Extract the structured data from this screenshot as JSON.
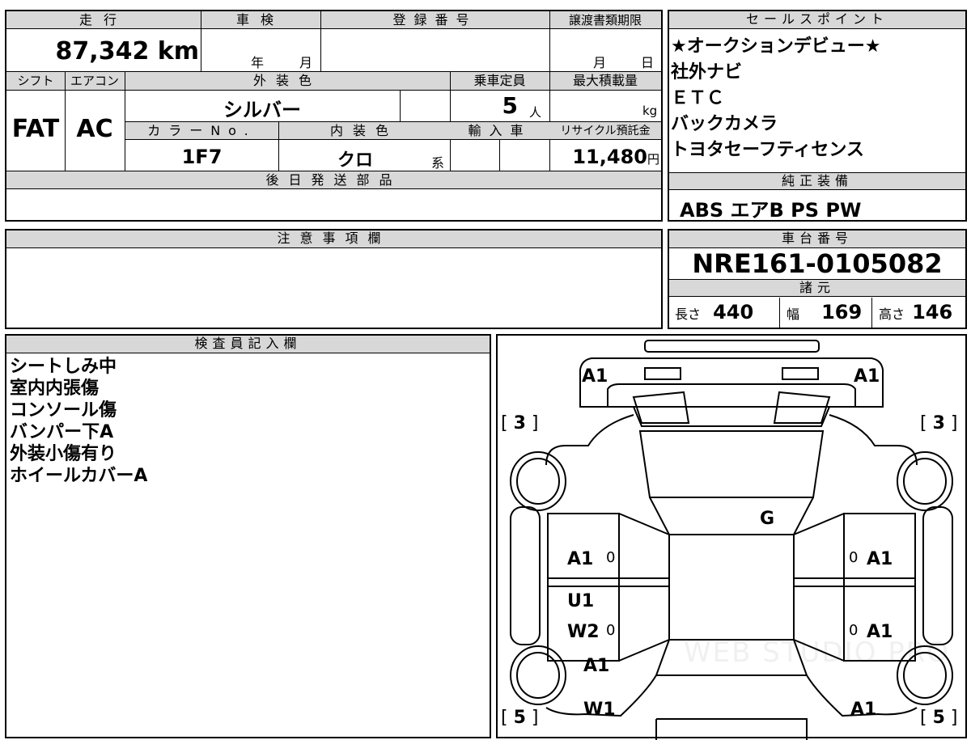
{
  "top_grid": {
    "headers": {
      "mileage": "走行",
      "inspection": "車検",
      "registration": "登録番号",
      "transfer_deadline": "譲渡書類期限",
      "shift": "シフト",
      "aircon": "エアコン",
      "exterior_color": "外装色",
      "capacity": "乗車定員",
      "max_load": "最大積載量",
      "color_no": "カラーNo.",
      "interior_color": "内装色",
      "import": "輸入車",
      "recycle": "リサイクル預託金",
      "later_parts": "後日発送部品"
    },
    "values": {
      "mileage": "87,342",
      "mileage_unit": "km",
      "inspection_year": "年",
      "inspection_month": "月",
      "transfer_month": "月",
      "transfer_day": "日",
      "shift": "FAT",
      "aircon": "AC",
      "exterior_color": "シルバー",
      "capacity": "5",
      "capacity_unit": "人",
      "max_load_unit": "kg",
      "color_no": "1F7",
      "interior_color": "クロ",
      "interior_suffix": "系",
      "recycle": "11,480",
      "recycle_unit": "円"
    }
  },
  "sales_points": {
    "header": "セールスポイント",
    "items": [
      "★オークションデビュー★",
      "社外ナビ",
      "ＥＴＣ",
      "バックカメラ",
      "トヨタセーフティセンス"
    ]
  },
  "genuine_equipment": {
    "header": "純正装備",
    "value": "ABS エアB PS PW"
  },
  "notes": {
    "header": "注意事項欄"
  },
  "chassis": {
    "header": "車台番号",
    "number": "NRE161-0105082",
    "specs_header": "諸元",
    "length_label": "長さ",
    "length": "440",
    "width_label": "幅",
    "width": "169",
    "height_label": "高さ",
    "height": "146"
  },
  "inspector": {
    "header": "検査員記入欄",
    "lines": [
      "シートしみ中",
      "室内内張傷",
      "コンソール傷",
      "バンパー下A",
      "外装小傷有り",
      "ホイールカバーA"
    ]
  },
  "diagram": {
    "marks": {
      "front_left": "A1",
      "front_right": "A1",
      "tire_fl": "3",
      "tire_fr": "3",
      "windshield": "G",
      "door_fl": "A1",
      "door_fr": "A1",
      "door_rl_1": "U1",
      "door_rl_2": "W2",
      "door_rr": "A1",
      "rear_left_1": "A1",
      "rear_left_2": "W1",
      "rear_right": "A1",
      "tire_rl": "5",
      "tire_rr": "5",
      "zero": "0"
    },
    "watermark": "WEB STUDIO PRO"
  }
}
